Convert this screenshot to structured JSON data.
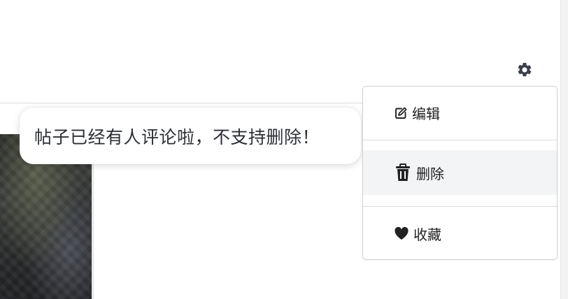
{
  "toast": {
    "message": "帖子已经有人评论啦，不支持删除！"
  },
  "settings": {
    "icon": "gear-icon"
  },
  "dropdown": {
    "items": [
      {
        "label": "编辑",
        "icon": "edit-icon"
      },
      {
        "label": "删除",
        "icon": "trash-icon",
        "highlighted": true
      },
      {
        "label": "收藏",
        "icon": "heart-icon"
      }
    ]
  },
  "colors": {
    "icon": "#3a3f4a",
    "hover_background": "#f3f4f6",
    "border": "#cfd1d4"
  }
}
